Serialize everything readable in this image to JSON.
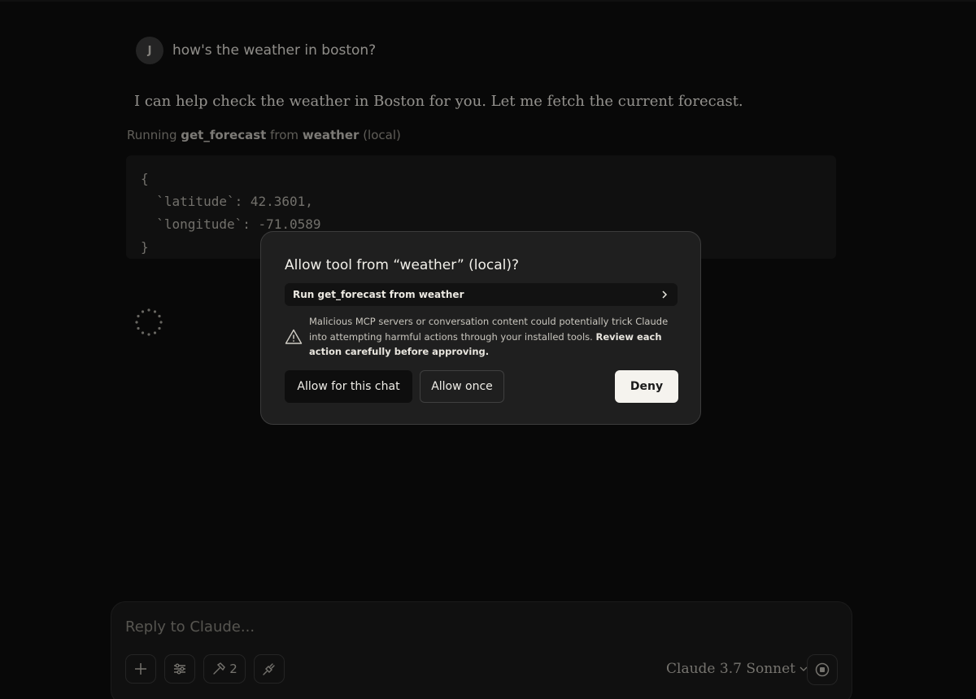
{
  "user_message": {
    "avatar_initial": "J",
    "text": "how's the weather in boston?"
  },
  "assistant": {
    "text": "I can help check the weather in Boston for you. Let me fetch the current forecast.",
    "tool_status": {
      "prefix": "Running",
      "tool": "get_forecast",
      "from": "from",
      "server": "weather",
      "scope": "(local)"
    },
    "code_lines": [
      "{",
      "  `latitude`: 42.3601,",
      "  `longitude`: -71.0589",
      "}"
    ]
  },
  "dialog": {
    "title": "Allow tool from “weather” (local)?",
    "tool_row_label": "Run get_forecast from weather",
    "warning_text": "Malicious MCP servers or conversation content could potentially trick Claude into attempting harmful actions through your installed tools.",
    "warning_bold": "Review each action carefully before approving.",
    "buttons": {
      "allow_chat": "Allow for this chat",
      "allow_once": "Allow once",
      "deny": "Deny"
    }
  },
  "composer": {
    "placeholder": "Reply to Claude...",
    "tools_count": "2",
    "model": "Claude 3.7 Sonnet"
  },
  "colors": {
    "background": "#0d0d0d",
    "dialog_bg": "#1f1f1f",
    "deny_bg": "#f5f3ee"
  }
}
